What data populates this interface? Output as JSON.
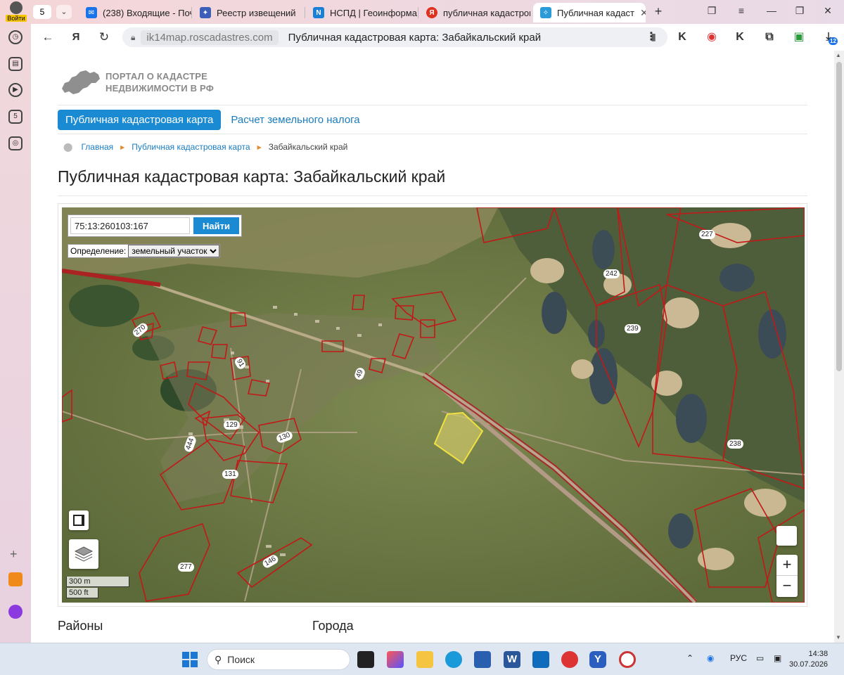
{
  "browser": {
    "login_label": "Войти",
    "tab_count": "5",
    "tabs": [
      {
        "title": "(238) Входящие - Почт",
        "icon": "mail-icon",
        "color": "#1a73e8"
      },
      {
        "title": "Реестр извещений",
        "icon": "emblem-icon",
        "color": "#3b5fb8"
      },
      {
        "title": "НСПД | Геоинформац",
        "icon": "nspd-icon",
        "color": "#1b7fd6"
      },
      {
        "title": "публичная кадастров",
        "icon": "yandex-icon",
        "color": "#e0311f"
      },
      {
        "title": "Публичная кадаст",
        "icon": "pkk-icon",
        "color": "#2a9ad8"
      }
    ],
    "url_domain": "ik14map.roscadastres.com",
    "url_title": "Публичная кадастровая карта: Забайкальский край",
    "ext_badge": "12"
  },
  "site": {
    "logo_line1": "ПОРТАЛ О КАДАСТРЕ",
    "logo_line2": "НЕДВИЖИМОСТИ В РФ",
    "menu_active": "Публичная кадастровая карта",
    "menu_item": "Расчет земельного налога",
    "breadcrumb": [
      "Главная",
      "Публичная кадастровая карта",
      "Забайкальский край"
    ],
    "heading": "Публичная кадастровая карта: Забайкальский край"
  },
  "map": {
    "search_value": "75:13:260103:167",
    "search_button": "Найти",
    "definition_label": "Определение:",
    "definition_value": "земельный участок",
    "scale_metric": "300 m",
    "scale_imperial": "500 ft",
    "zoom_in": "+",
    "zoom_out": "−",
    "parcel_labels": [
      "270",
      "91",
      "49",
      "129",
      "444",
      "130",
      "131",
      "277",
      "146",
      "242",
      "239",
      "227",
      "238"
    ]
  },
  "sections": {
    "districts": "Районы",
    "cities": "Города"
  },
  "taskbar": {
    "search_placeholder": "Поиск",
    "lang": "РУС",
    "time": "14:38",
    "date": "30.07.2026"
  }
}
